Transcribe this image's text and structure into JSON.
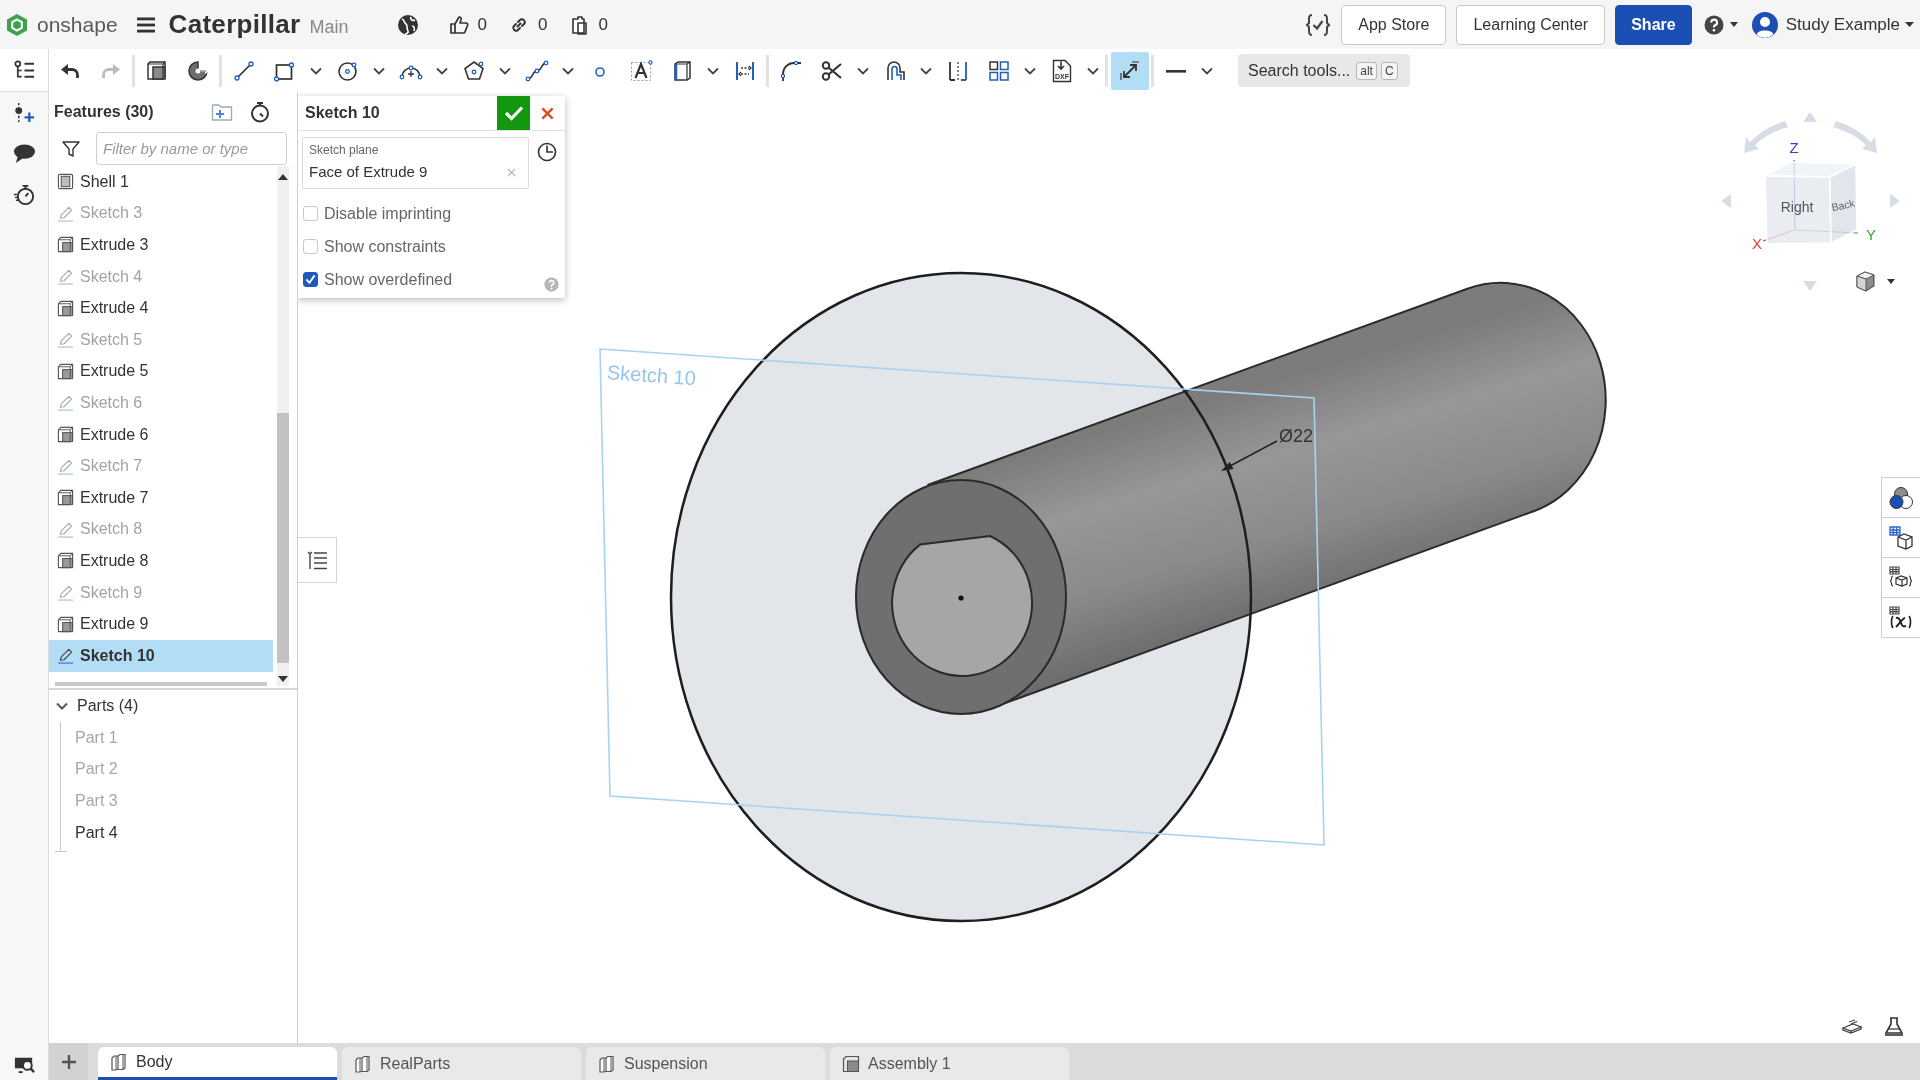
{
  "top_bar": {
    "logo": "onshape",
    "document_title": "Caterpillar",
    "branch": "Main",
    "counters": [
      {
        "kind": "likes",
        "value": "0"
      },
      {
        "kind": "links",
        "value": "0"
      },
      {
        "kind": "copies",
        "value": "0"
      }
    ],
    "buttons": [
      {
        "kind": "outline",
        "label": "App Store"
      },
      {
        "kind": "outline",
        "label": "Learning Center"
      },
      {
        "kind": "primary",
        "label": "Share"
      }
    ],
    "user": "Study Example"
  },
  "toolbar": {
    "groups": [
      [
        {
          "kind": "undo",
          "disabled": false,
          "selected": false
        },
        {
          "kind": "redo",
          "disabled": true,
          "selected": false
        }
      ],
      [
        {
          "kind": "solid",
          "disabled": false,
          "selected": false
        },
        {
          "kind": "pie",
          "disabled": false,
          "selected": false
        }
      ],
      [
        {
          "kind": "line",
          "disabled": false,
          "selected": false
        },
        {
          "kind": "rectangle",
          "disabled": false,
          "selected": false
        },
        {
          "kind": "dropdown",
          "disabled": false,
          "selected": false
        },
        {
          "kind": "circle",
          "disabled": false,
          "selected": false
        },
        {
          "kind": "dropdown",
          "disabled": false,
          "selected": false
        },
        {
          "kind": "arc",
          "disabled": false,
          "selected": false
        },
        {
          "kind": "dropdown",
          "disabled": false,
          "selected": false
        },
        {
          "kind": "polygon",
          "disabled": false,
          "selected": false
        },
        {
          "kind": "dropdown",
          "disabled": false,
          "selected": false
        },
        {
          "kind": "spline",
          "disabled": false,
          "selected": false
        },
        {
          "kind": "dropdown",
          "disabled": false,
          "selected": false
        },
        {
          "kind": "point",
          "disabled": false,
          "selected": false
        },
        {
          "kind": "text",
          "disabled": false,
          "selected": false
        },
        {
          "kind": "construction",
          "disabled": false,
          "selected": false
        },
        {
          "kind": "dropdown",
          "disabled": false,
          "selected": false
        },
        {
          "kind": "dimension",
          "disabled": false,
          "selected": false
        }
      ],
      [
        {
          "kind": "fillet",
          "disabled": false,
          "selected": false
        },
        {
          "kind": "trim",
          "disabled": false,
          "selected": false
        },
        {
          "kind": "dropdown",
          "disabled": false,
          "selected": false
        },
        {
          "kind": "offset",
          "disabled": false,
          "selected": false
        },
        {
          "kind": "dropdown",
          "disabled": false,
          "selected": false
        },
        {
          "kind": "mirror",
          "disabled": false,
          "selected": false
        },
        {
          "kind": "pattern",
          "disabled": false,
          "selected": false
        },
        {
          "kind": "dropdown",
          "disabled": false,
          "selected": false
        },
        {
          "kind": "dxf",
          "label": "DXF",
          "disabled": false,
          "selected": false
        },
        {
          "kind": "dropdown",
          "disabled": false,
          "selected": false
        }
      ],
      [
        {
          "kind": "snap",
          "disabled": false,
          "selected": true
        }
      ],
      [
        {
          "kind": "line_style",
          "disabled": false,
          "selected": false
        },
        {
          "kind": "dropdown",
          "disabled": false,
          "selected": false
        }
      ]
    ],
    "search": {
      "label": "Search tools...",
      "keys": [
        "alt",
        "C"
      ]
    }
  },
  "features_panel": {
    "title": "Features (30)",
    "filter": {
      "placeholder": "Filter by name or type"
    },
    "items": [
      {
        "kind": "shell",
        "label": "Shell 1",
        "dimmed": false,
        "selected": false
      },
      {
        "kind": "sketch",
        "label": "Sketch 3",
        "dimmed": true,
        "selected": false
      },
      {
        "kind": "extrude",
        "label": "Extrude 3",
        "dimmed": false,
        "selected": false
      },
      {
        "kind": "sketch",
        "label": "Sketch 4",
        "dimmed": true,
        "selected": false
      },
      {
        "kind": "extrude",
        "label": "Extrude 4",
        "dimmed": false,
        "selected": false
      },
      {
        "kind": "sketch",
        "label": "Sketch 5",
        "dimmed": true,
        "selected": false
      },
      {
        "kind": "extrude",
        "label": "Extrude 5",
        "dimmed": false,
        "selected": false
      },
      {
        "kind": "sketch",
        "label": "Sketch 6",
        "dimmed": true,
        "selected": false
      },
      {
        "kind": "extrude",
        "label": "Extrude 6",
        "dimmed": false,
        "selected": false
      },
      {
        "kind": "sketch",
        "label": "Sketch 7",
        "dimmed": true,
        "selected": false
      },
      {
        "kind": "extrude",
        "label": "Extrude 7",
        "dimmed": false,
        "selected": false
      },
      {
        "kind": "sketch",
        "label": "Sketch 8",
        "dimmed": true,
        "selected": false
      },
      {
        "kind": "extrude",
        "label": "Extrude 8",
        "dimmed": false,
        "selected": false
      },
      {
        "kind": "sketch",
        "label": "Sketch 9",
        "dimmed": true,
        "selected": false
      },
      {
        "kind": "extrude",
        "label": "Extrude 9",
        "dimmed": false,
        "selected": false
      },
      {
        "kind": "sketch",
        "label": "Sketch 10",
        "dimmed": false,
        "selected": true
      }
    ],
    "parts": {
      "label": "Parts (4)",
      "expanded": true,
      "children": [
        {
          "label": "Part 1",
          "dimmed": true,
          "selected": false
        },
        {
          "label": "Part 2",
          "dimmed": true,
          "selected": false
        },
        {
          "label": "Part 3",
          "dimmed": true,
          "selected": false
        },
        {
          "label": "Part 4",
          "dimmed": false,
          "selected": false
        }
      ]
    }
  },
  "sketch_dialog": {
    "title": "Sketch 10",
    "field": {
      "label": "Sketch plane",
      "value": "Face of Extrude 9"
    },
    "options": [
      {
        "label": "Disable imprinting",
        "checked": false
      },
      {
        "label": "Show constraints",
        "checked": false
      },
      {
        "label": "Show overdefined",
        "checked": true
      }
    ]
  },
  "viewport": {
    "sketch_label": "Sketch 10",
    "dimension": "Ø22",
    "view_cube": {
      "faces": [
        "Right",
        "Back"
      ],
      "axes": [
        "X",
        "Y",
        "Z"
      ]
    }
  },
  "tabs": [
    {
      "kind": "part_studio",
      "label": "Body",
      "selected": true
    },
    {
      "kind": "part_studio",
      "label": "RealParts",
      "selected": false
    },
    {
      "kind": "part_studio",
      "label": "Suspension",
      "selected": false
    },
    {
      "kind": "assembly",
      "label": "Assembly 1",
      "selected": false
    }
  ]
}
